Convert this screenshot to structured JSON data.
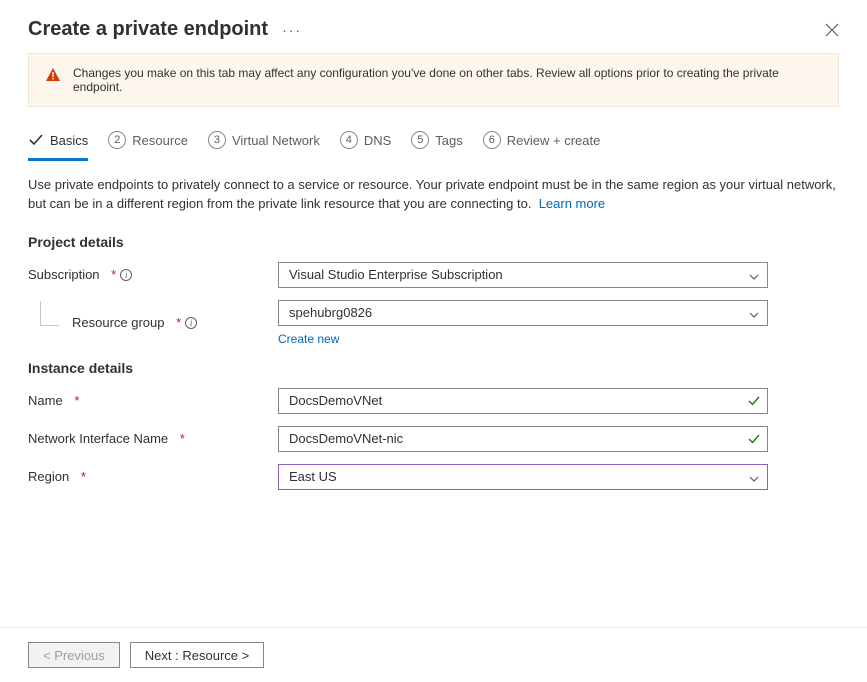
{
  "header": {
    "title": "Create a private endpoint"
  },
  "alert": {
    "text": "Changes you make on this tab may affect any configuration you've done on other tabs. Review all options prior to creating the private endpoint."
  },
  "tabs": [
    {
      "num": "✓",
      "label": "Basics",
      "active": true
    },
    {
      "num": "2",
      "label": "Resource"
    },
    {
      "num": "3",
      "label": "Virtual Network"
    },
    {
      "num": "4",
      "label": "DNS"
    },
    {
      "num": "5",
      "label": "Tags"
    },
    {
      "num": "6",
      "label": "Review + create"
    }
  ],
  "intro": {
    "text": "Use private endpoints to privately connect to a service or resource. Your private endpoint must be in the same region as your virtual network, but can be in a different region from the private link resource that you are connecting to.",
    "learnMore": "Learn more"
  },
  "sections": {
    "projectDetails": "Project details",
    "instanceDetails": "Instance details"
  },
  "form": {
    "subscription": {
      "label": "Subscription",
      "value": "Visual Studio Enterprise Subscription"
    },
    "resourceGroup": {
      "label": "Resource group",
      "value": "spehubrg0826",
      "createNew": "Create new"
    },
    "name": {
      "label": "Name",
      "value": "DocsDemoVNet"
    },
    "nicName": {
      "label": "Network Interface Name",
      "value": "DocsDemoVNet-nic"
    },
    "region": {
      "label": "Region",
      "value": "East US"
    }
  },
  "footer": {
    "previous": "< Previous",
    "next": "Next : Resource >"
  }
}
